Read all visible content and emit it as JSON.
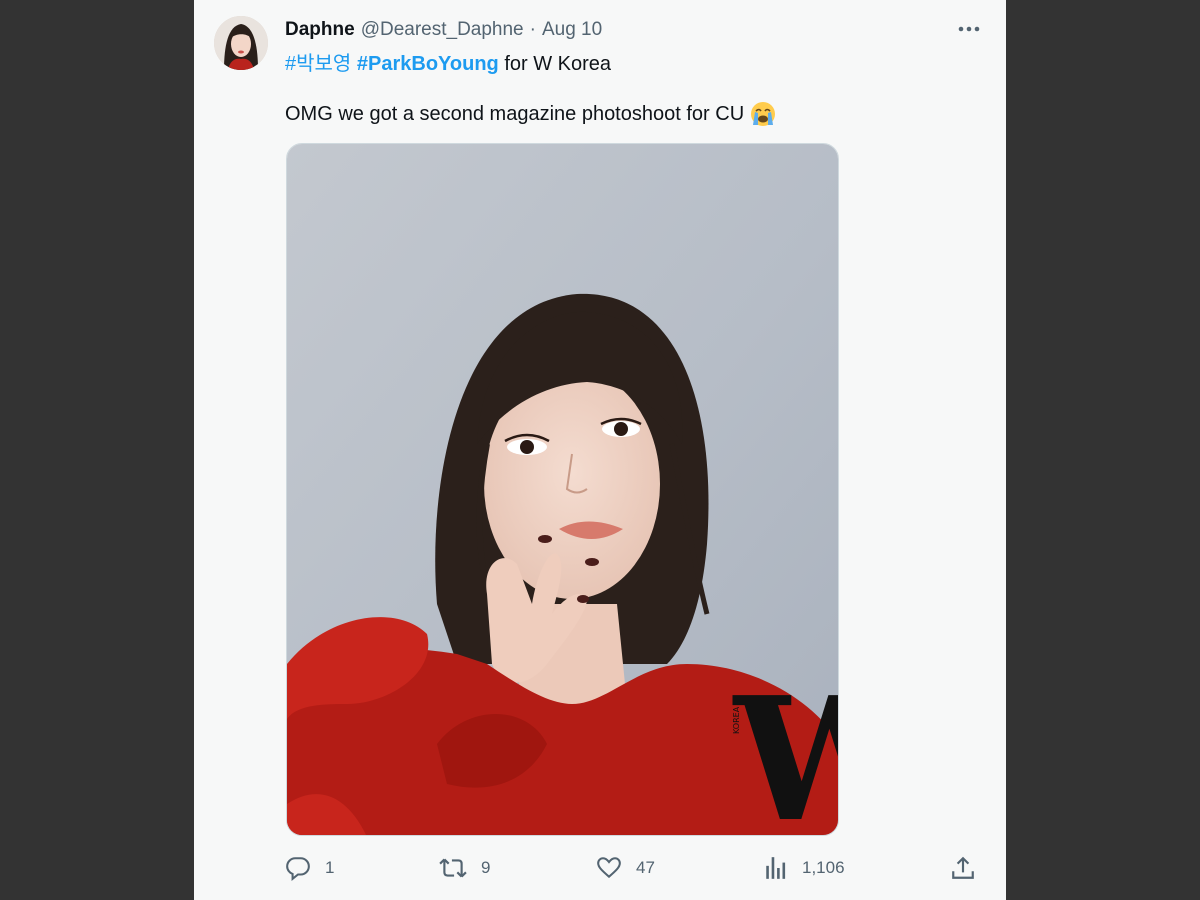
{
  "tweet": {
    "display_name": "Daphne",
    "handle": "@Dearest_Daphne",
    "separator": "·",
    "date": "Aug 10",
    "hashtag1": "#박보영",
    "hashtag2": "#ParkBoYoung",
    "line1_rest": " for W Korea",
    "line2": "OMG we got a second magazine photoshoot for CU",
    "emoji": "loudly-crying-face-emoji",
    "media": {
      "watermark": "W",
      "watermark_small": "KOREA"
    }
  },
  "actions": {
    "replies": "1",
    "retweets": "9",
    "likes": "47",
    "views": "1,106"
  },
  "icons": {
    "more": "more-dots-icon",
    "reply": "reply-icon",
    "retweet": "retweet-icon",
    "like": "heart-icon",
    "views": "views-chart-icon",
    "share": "share-icon"
  },
  "colors": {
    "background": "#333333",
    "panel": "#f7f8f8",
    "link": "#1d9bf0",
    "text": "#0f1419",
    "muted": "#536471"
  }
}
